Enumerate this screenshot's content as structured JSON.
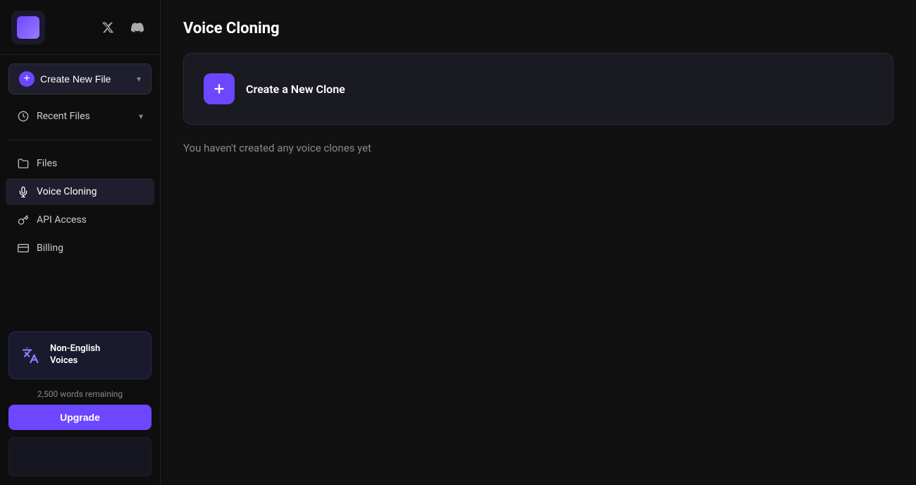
{
  "sidebar": {
    "logo_alt": "App Logo",
    "social": [
      {
        "name": "twitter-x",
        "symbol": "𝕏"
      },
      {
        "name": "discord",
        "symbol": "⊕"
      }
    ],
    "create_button": {
      "label": "Create New File",
      "plus": "+"
    },
    "recent_files": {
      "label": "Recent Files",
      "chevron": "▾"
    },
    "nav_items": [
      {
        "id": "files",
        "label": "Files",
        "icon": "folder"
      },
      {
        "id": "voice-cloning",
        "label": "Voice Cloning",
        "icon": "wave",
        "active": true
      },
      {
        "id": "api-access",
        "label": "API Access",
        "icon": "key"
      },
      {
        "id": "billing",
        "label": "Billing",
        "icon": "card"
      }
    ],
    "non_english": {
      "label": "Non-English",
      "label2": "Voices",
      "icon": "translate"
    },
    "words_remaining": "2,500 words remaining",
    "upgrade_label": "Upgrade"
  },
  "main": {
    "title": "Voice Cloning",
    "create_clone_label": "Create a New Clone",
    "empty_state": "You haven't created any voice clones yet"
  }
}
